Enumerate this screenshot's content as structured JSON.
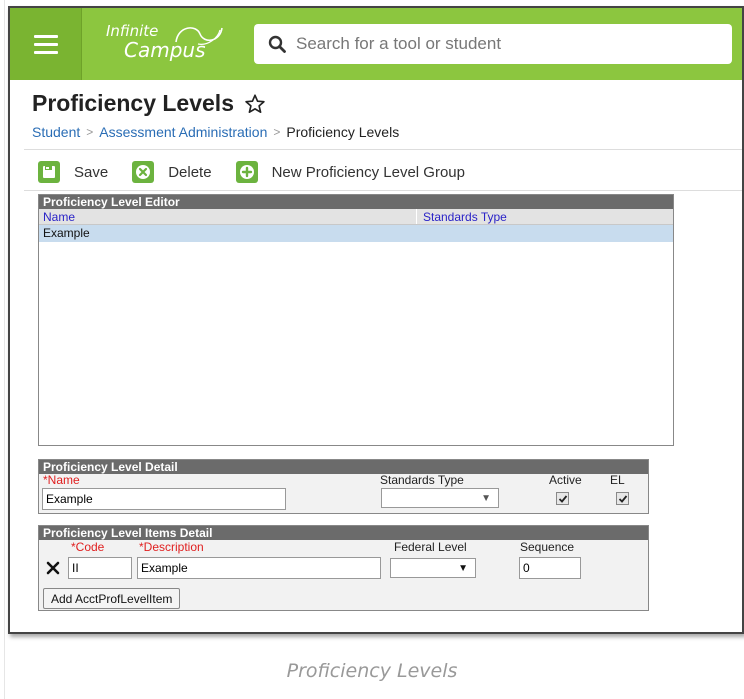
{
  "app": {
    "logo_line1": "Infinite",
    "logo_line2": "Campus"
  },
  "search": {
    "placeholder": "Search for a tool or student"
  },
  "header": {
    "title": "Proficiency Levels",
    "breadcrumb": [
      "Student",
      "Assessment Administration",
      "Proficiency Levels"
    ]
  },
  "toolbar": {
    "save_label": "Save",
    "delete_label": "Delete",
    "new_group_label": "New Proficiency Level Group"
  },
  "editor": {
    "title": "Proficiency Level Editor",
    "columns": [
      "Name",
      "Standards Type"
    ],
    "rows": [
      {
        "name": "Example",
        "standards_type": ""
      }
    ]
  },
  "detail": {
    "title": "Proficiency Level Detail",
    "name_req": "*",
    "name_label": "Name",
    "name_value": "Example",
    "standards_type_label": "Standards Type",
    "standards_type_value": "",
    "active_label": "Active",
    "active_checked": true,
    "el_label": "EL",
    "el_checked": true
  },
  "items": {
    "title": "Proficiency Level Items Detail",
    "code_label": "*Code",
    "description_label": "*Description",
    "federal_level_label": "Federal Level",
    "sequence_label": "Sequence",
    "rows": [
      {
        "code": "II",
        "description": "Example",
        "federal_level": "",
        "sequence": "0"
      }
    ],
    "add_label": "Add AcctProfLevelItem"
  },
  "caption": "Proficiency Levels",
  "colors": {
    "brand_green": "#8cc63f",
    "link_blue": "#2a6db5",
    "header_gray": "#6b6b6b",
    "selected_row": "#c8dcee",
    "required_red": "#e02020"
  }
}
